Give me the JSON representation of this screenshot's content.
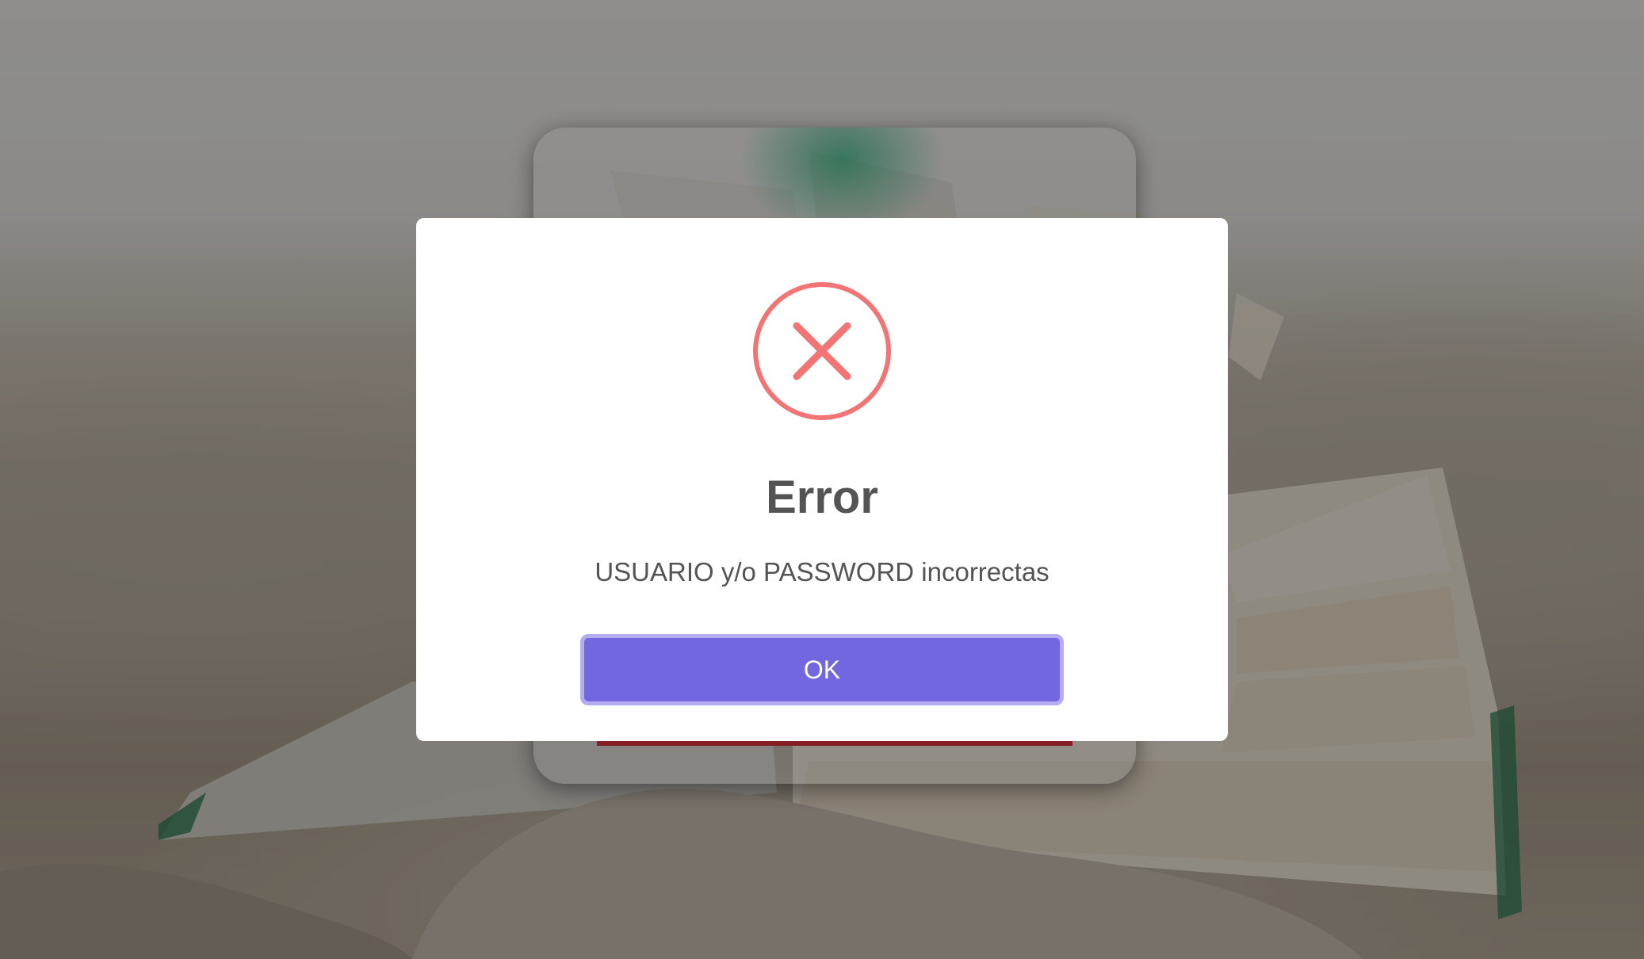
{
  "dialog": {
    "icon": "error-x-icon",
    "title": "Error",
    "message": "USUARIO y/o PASSWORD incorrectas",
    "ok_label": "OK"
  },
  "colors": {
    "error_icon": "#f27474",
    "ok_button": "#7367e1",
    "ok_button_focus_ring": "#b4adf2",
    "text": "#545454",
    "login_button_accent": "#e0343e",
    "login_glow": "#46be8c"
  }
}
